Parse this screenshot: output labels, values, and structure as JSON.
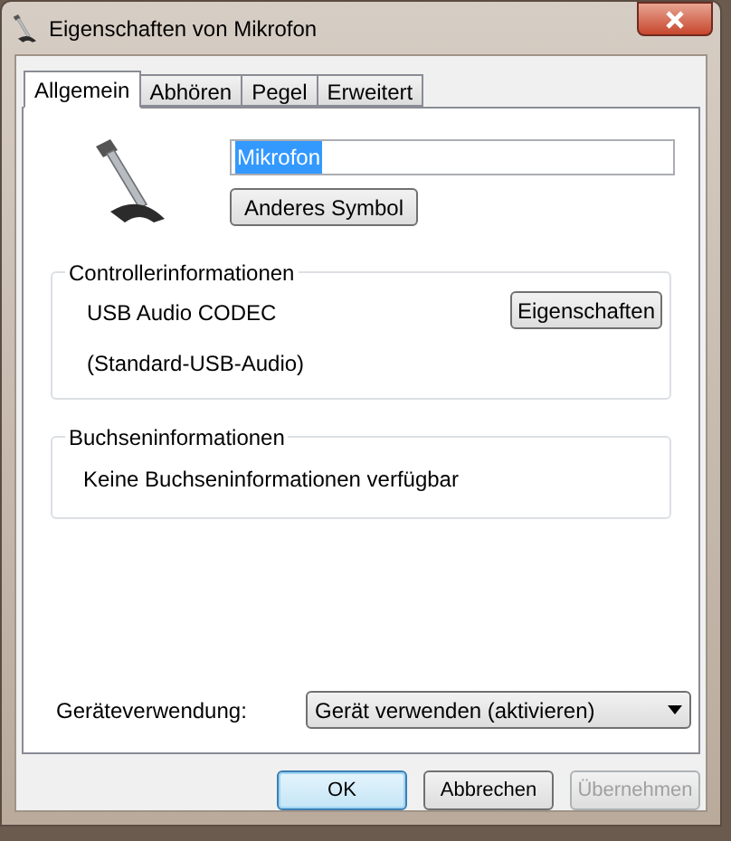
{
  "window": {
    "title": "Eigenschaften von Mikrofon"
  },
  "tabs": [
    {
      "label": "Allgemein",
      "selected": true
    },
    {
      "label": "Abhören",
      "selected": false
    },
    {
      "label": "Pegel",
      "selected": false
    },
    {
      "label": "Erweitert",
      "selected": false
    }
  ],
  "name_field": {
    "value": "Mikrofon"
  },
  "change_icon_button": "Anderes Symbol",
  "controller_group": {
    "title": "Controllerinformationen",
    "lines": [
      "USB Audio CODEC",
      "(Standard-USB-Audio)"
    ],
    "button": "Eigenschaften"
  },
  "jack_group": {
    "title": "Buchseninformationen",
    "text": "Keine Buchseninformationen verfügbar"
  },
  "device_usage": {
    "label": "Geräteverwendung:",
    "value": "Gerät verwenden (aktivieren)"
  },
  "buttons": [
    {
      "label": "OK",
      "kind": "default",
      "disabled": false
    },
    {
      "label": "Abbrechen",
      "kind": "normal",
      "disabled": false
    },
    {
      "label": "Übernehmen",
      "kind": "normal",
      "disabled": true
    }
  ]
}
